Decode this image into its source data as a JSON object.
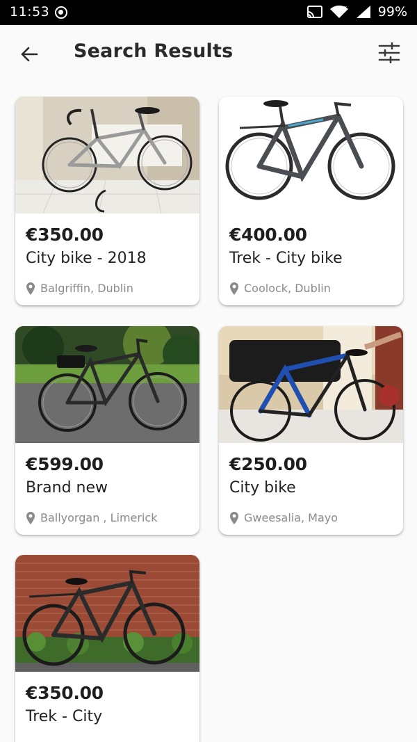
{
  "status_bar": {
    "time": "11:53",
    "battery": "99%"
  },
  "header": {
    "title": "Search Results",
    "back_icon": "arrow-back-icon",
    "filter_icon": "tune-icon"
  },
  "colors": {
    "background": "#fafafa",
    "card": "#ffffff",
    "text_primary": "#202020",
    "text_secondary": "#8a8a8a"
  },
  "listings": [
    {
      "price": "€350.00",
      "title": "City bike - 2018",
      "location": "Balgriffin, Dublin"
    },
    {
      "price": "€400.00",
      "title": "Trek - City bike",
      "location": "Coolock, Dublin"
    },
    {
      "price": "€599.00",
      "title": "Brand new",
      "location": "Ballyorgan , Limerick"
    },
    {
      "price": "€250.00",
      "title": "City bike",
      "location": "Gweesalia, Mayo"
    },
    {
      "price": "€350.00",
      "title": "Trek - City",
      "location": ""
    }
  ]
}
